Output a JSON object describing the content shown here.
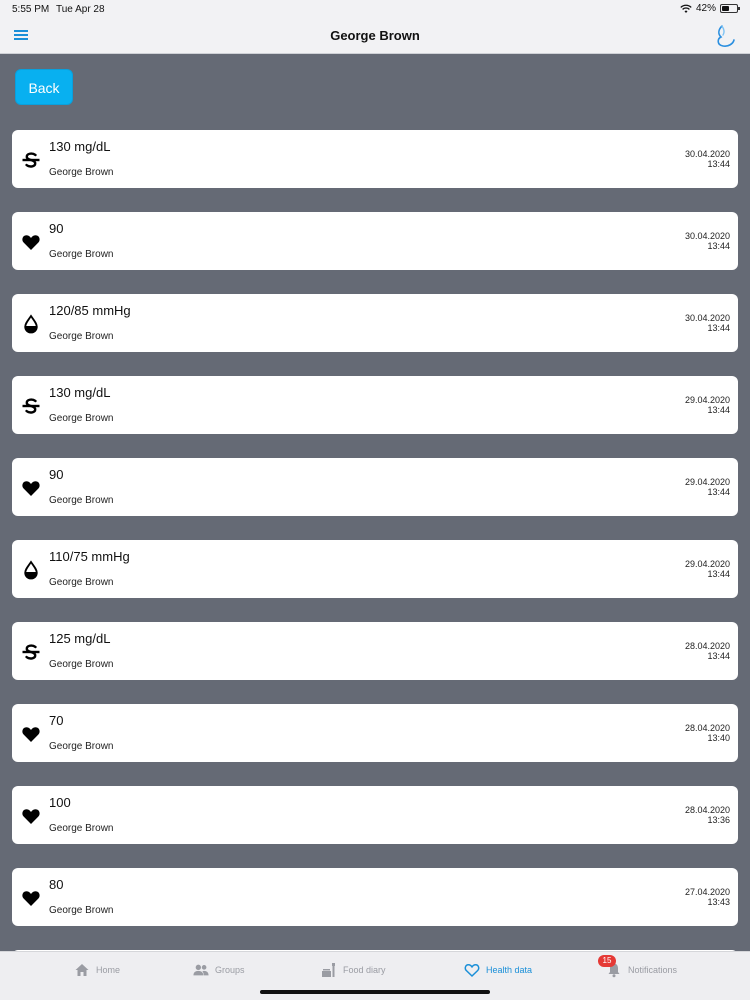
{
  "status_bar": {
    "time": "5:55 PM",
    "date": "Tue Apr 28",
    "battery": "42%"
  },
  "header": {
    "title": "George Brown",
    "menu_icon": "hamburger-menu-icon",
    "logo_icon": "app-logo-icon"
  },
  "back_label": "Back",
  "records": [
    {
      "icon": "glucose",
      "value": "130 mg/dL",
      "name": "George Brown",
      "date": "30.04.2020",
      "time": "13:44"
    },
    {
      "icon": "heart",
      "value": "90",
      "name": "George Brown",
      "date": "30.04.2020",
      "time": "13:44"
    },
    {
      "icon": "drop",
      "value": "120/85 mmHg",
      "name": "George Brown",
      "date": "30.04.2020",
      "time": "13:44"
    },
    {
      "icon": "glucose",
      "value": "130 mg/dL",
      "name": "George Brown",
      "date": "29.04.2020",
      "time": "13:44"
    },
    {
      "icon": "heart",
      "value": "90",
      "name": "George Brown",
      "date": "29.04.2020",
      "time": "13:44"
    },
    {
      "icon": "drop",
      "value": "110/75 mmHg",
      "name": "George Brown",
      "date": "29.04.2020",
      "time": "13:44"
    },
    {
      "icon": "glucose",
      "value": "125 mg/dL",
      "name": "George Brown",
      "date": "28.04.2020",
      "time": "13:44"
    },
    {
      "icon": "heart",
      "value": "70",
      "name": "George Brown",
      "date": "28.04.2020",
      "time": "13:40"
    },
    {
      "icon": "heart",
      "value": "100",
      "name": "George Brown",
      "date": "28.04.2020",
      "time": "13:36"
    },
    {
      "icon": "heart",
      "value": "80",
      "name": "George Brown",
      "date": "27.04.2020",
      "time": "13:43"
    }
  ],
  "tabs": [
    {
      "label": "Home",
      "icon": "home-icon",
      "active": false
    },
    {
      "label": "Groups",
      "icon": "groups-icon",
      "active": false
    },
    {
      "label": "Food diary",
      "icon": "food-diary-icon",
      "active": false
    },
    {
      "label": "Health data",
      "icon": "heart-outline-icon",
      "active": true
    },
    {
      "label": "Notifications",
      "icon": "bell-icon",
      "active": false,
      "badge": "15"
    }
  ],
  "colors": {
    "accent": "#1a8fd8",
    "back_button": "#08b0f0",
    "background": "#656a75",
    "badge": "#e53935"
  }
}
